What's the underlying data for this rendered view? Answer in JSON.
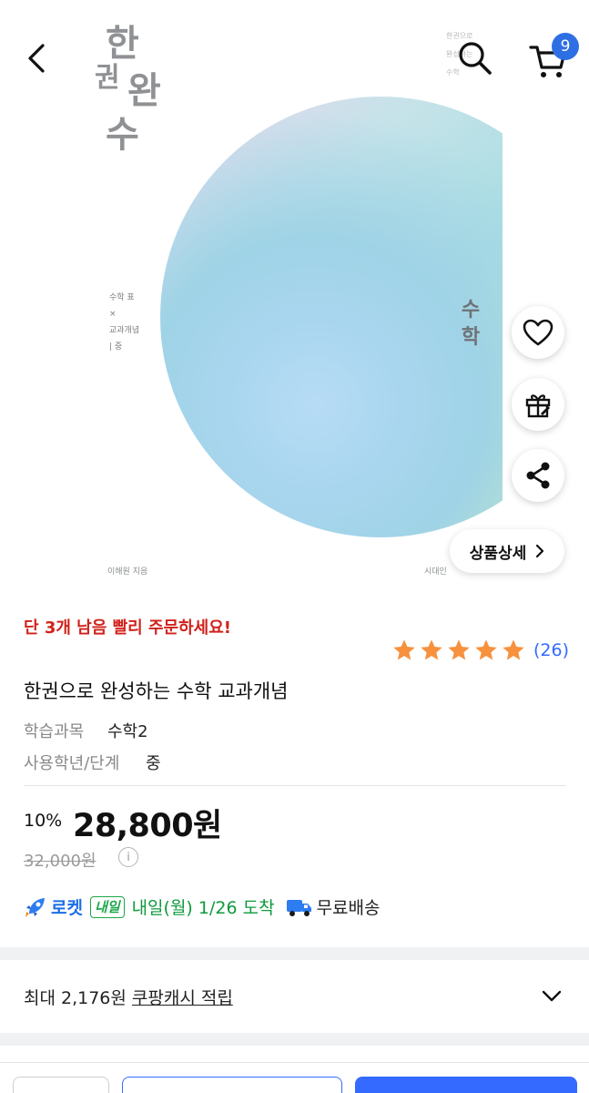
{
  "header": {
    "cart_count": "9"
  },
  "cover": {
    "title_chars": [
      "한",
      "권",
      "완",
      "수"
    ],
    "vertical_text": "수학",
    "note_lines": [
      "수학 표",
      "×",
      "교과개념",
      "| 중"
    ],
    "author": "이해원 지음",
    "publisher": "시대인",
    "tiny_lines": [
      "한권으로",
      "완성하는",
      "수학"
    ]
  },
  "actions": {
    "detail_label": "상품상세"
  },
  "product": {
    "urgent_notice": "단 3개 남음 빨리 주문하세요!",
    "rating_stars": 5,
    "rating_count": "(26)",
    "title": "한권으로 완성하는 수학 교과개념",
    "specs": [
      {
        "key": "학습과목",
        "value": "수학2"
      },
      {
        "key": "사용학년/단계",
        "value": "중"
      }
    ],
    "discount_rate": "10%",
    "price": "28,800원",
    "original_price": "32,000원"
  },
  "delivery": {
    "rocket_label": "로켓",
    "badge": "내일",
    "arrival": "내일(월) 1/26 도착",
    "free_shipping": "무료배송"
  },
  "cash": {
    "prefix": "최대 2,176원",
    "link": "쿠팡캐시 적립"
  },
  "colors": {
    "accent": "#346aff",
    "urgent": "#d0221b",
    "star": "#f7913d",
    "arrival": "#0d9a3c"
  }
}
